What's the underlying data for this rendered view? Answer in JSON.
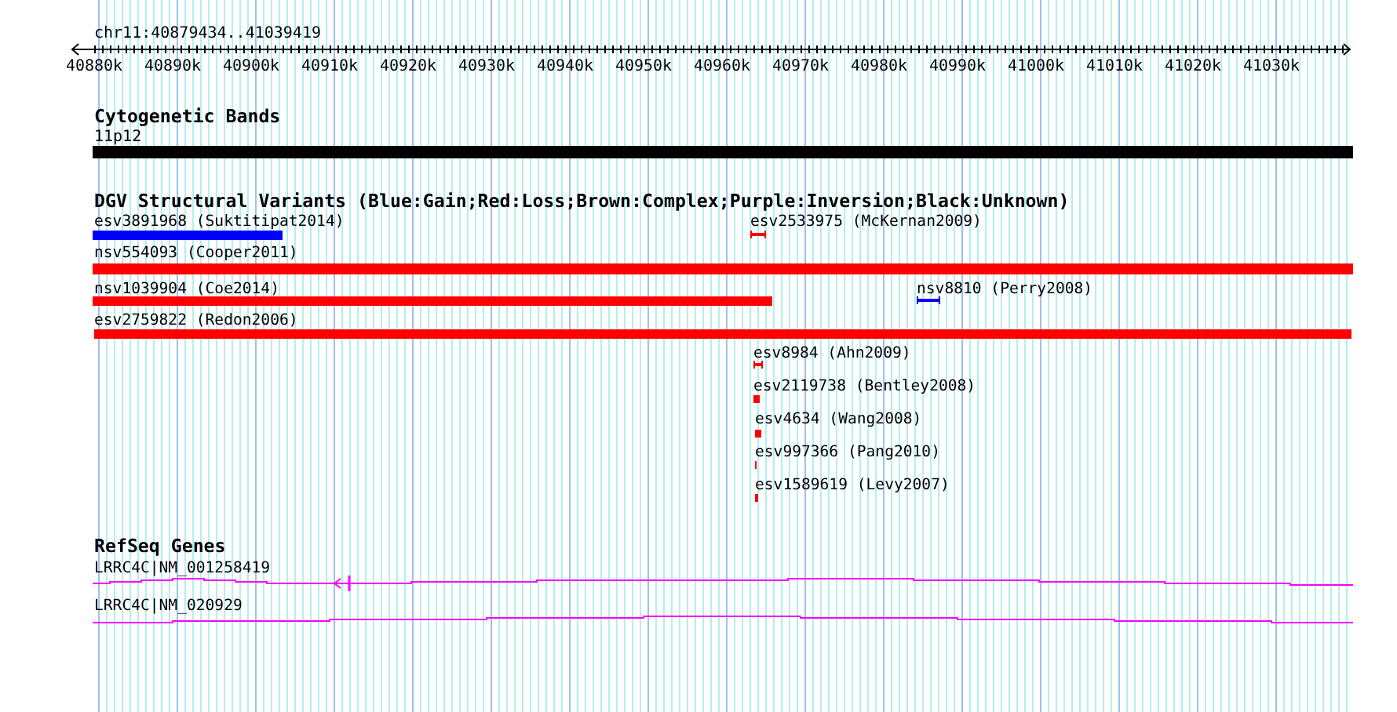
{
  "ruler": {
    "region": "chr11:40879434..41039419",
    "ticks": [
      "40880k",
      "40890k",
      "40900k",
      "40910k",
      "40920k",
      "40930k",
      "40940k",
      "40950k",
      "40960k",
      "40970k",
      "40980k",
      "40990k",
      "41000k",
      "41010k",
      "41020k",
      "41030k"
    ]
  },
  "cytoband_track": {
    "title": "Cytogenetic Bands",
    "bands": [
      {
        "label": "11p12"
      }
    ]
  },
  "dgv_track": {
    "title": "DGV Structural Variants (Blue:Gain;Red:Loss;Brown:Complex;Purple:Inversion;Black:Unknown)",
    "variants": [
      {
        "label": "esv3891968 (Suktitipat2014)",
        "color": "#0000ff"
      },
      {
        "label": "esv2533975 (McKernan2009)",
        "color": "#ff0000"
      },
      {
        "label": "nsv554093 (Cooper2011)",
        "color": "#ff0000"
      },
      {
        "label": "nsv1039904 (Coe2014)",
        "color": "#ff0000"
      },
      {
        "label": "nsv8810 (Perry2008)",
        "color": "#0000ff"
      },
      {
        "label": "esv2759822 (Redon2006)",
        "color": "#ff0000"
      },
      {
        "label": "esv8984 (Ahn2009)",
        "color": "#ff0000"
      },
      {
        "label": "esv2119738 (Bentley2008)",
        "color": "#ff0000"
      },
      {
        "label": "esv4634 (Wang2008)",
        "color": "#ff0000"
      },
      {
        "label": "esv997366 (Pang2010)",
        "color": "#ff0000"
      },
      {
        "label": "esv1589619 (Levy2007)",
        "color": "#ff0000"
      }
    ]
  },
  "refseq_track": {
    "title": "RefSeq Genes",
    "genes": [
      {
        "label": "LRRC4C|NM_001258419"
      },
      {
        "label": "LRRC4C|NM_020929"
      }
    ]
  }
}
